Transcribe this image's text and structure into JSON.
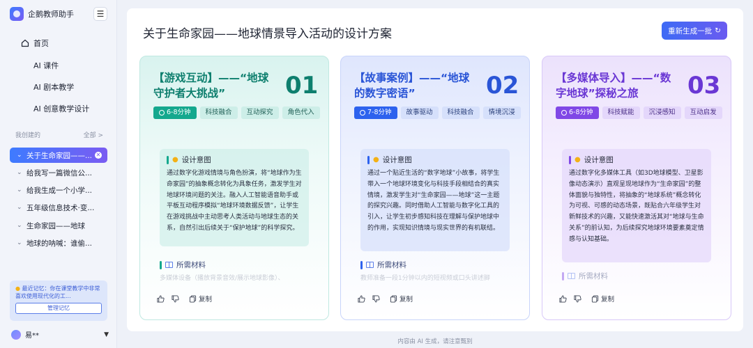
{
  "app": {
    "name": "企鹅教师助手"
  },
  "nav": {
    "home": "首页",
    "items": [
      "AI 课件",
      "AI 剧本教学",
      "AI 创意教学设计"
    ]
  },
  "history": {
    "header": "我创建的",
    "all_link": "全部 >",
    "items": [
      "关于生命家园——...",
      "给我写一篇微信公...",
      "给我生成一个小学...",
      "五年级信息技术·变...",
      "生命家园——地球",
      "地球的呐喊：谁偷..."
    ]
  },
  "memory": {
    "text": "最近记忆：你在课堂教学中非常喜欢使用现代化的工...",
    "button": "管理记忆"
  },
  "user": {
    "name": "易**"
  },
  "main": {
    "title": "关于生命家园——地球情景导入活动的设计方案",
    "regen_button": "重新生成一批"
  },
  "cards": [
    {
      "title": "【游戏互动】——“地球守护者大挑战”",
      "number": "01",
      "time": "6-8分钟",
      "tags": [
        "科技融合",
        "互动探究",
        "角色代入"
      ],
      "intent_label": "设计意图",
      "intent": "通过数字化游戏情境与角色扮演，将“地球作为生命家园”的抽象概念转化为具象任务，激发学生对地球环境问题的关注。融入人工智能语音助手或平板互动程序模拟“地球环境数据反馈”，让学生在游戏挑战中主动思考人类活动与地球生态的关系，自然引出后续关于“保护地球”的科学探究。",
      "materials_label": "所需材料",
      "materials": "多媒体设备（播放背景音效/展示地球影像）、",
      "copy": "复制"
    },
    {
      "title": "【故事案例】——“地球的数字密语”",
      "number": "02",
      "time": "7-8分钟",
      "tags": [
        "故事驱动",
        "科技融合",
        "情境沉浸"
      ],
      "intent_label": "设计意图",
      "intent": "通过一个贴近生活的“数字地球”小故事，将学生带入一个地球环境变化与科技手段相结合的真实情境，激发学生对“生命家园——地球”这一主题的探究兴趣。同时借助人工智能与数字化工具的引入，让学生初步感知科技在理解与保护地球中的作用，实现知识情境与现实世界的有机联结。",
      "materials_label": "所需材料",
      "materials": "教师准备一段1分钟以内的短视频或口头讲述脚",
      "copy": "复制"
    },
    {
      "title": "【多媒体导入】——“数字地球”探秘之旅",
      "number": "03",
      "time": "6-8分钟",
      "tags": [
        "科技赋能",
        "沉浸感知",
        "互动启发"
      ],
      "intent_label": "设计意图",
      "intent": "通过数字化多媒体工具（如3D地球模型、卫星影像动态演示）直观呈现地球作为“生命家园”的整体面貌与独特性，将抽象的“地球系统”概念转化为可视、可感的动态场景，既贴合六年级学生对新鲜技术的兴趣，又能快速激活其对“地球与生命关系”的前认知，为后续探究地球环境要素奠定情感与认知基础。",
      "materials_label": "所需材料",
      "materials": "",
      "copy": "复制"
    }
  ],
  "footer": "内容由 AI 生成，请注意甄别",
  "colors": {
    "teal": "#14a88e",
    "blue": "#2d62ee",
    "purple": "#8048e6"
  }
}
